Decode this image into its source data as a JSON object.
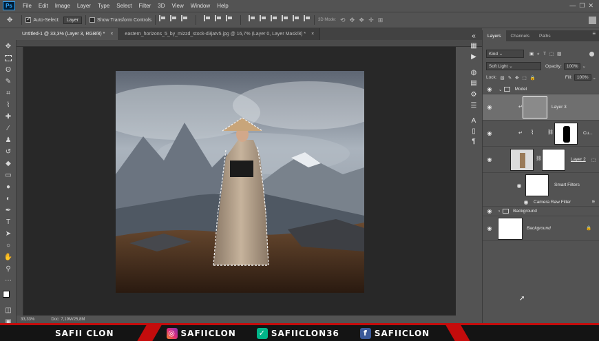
{
  "app": {
    "logo": "Ps"
  },
  "menu": [
    "File",
    "Edit",
    "Image",
    "Layer",
    "Type",
    "Select",
    "Filter",
    "3D",
    "View",
    "Window",
    "Help"
  ],
  "options_bar": {
    "auto_select_label": "Auto-Select:",
    "auto_select_value": "Layer",
    "transform_label": "Show Transform Controls",
    "mode_label": "3D Mode:"
  },
  "doc_tabs": [
    {
      "title": "Untitled-1 @ 33,3% (Layer 3, RGB/8) *",
      "close": "×"
    },
    {
      "title": "eastern_horizons_5_by_mizzd_stock-d3jatv5.jpg @ 16,7% (Layer 0, Layer Mask/8) *",
      "close": "×"
    }
  ],
  "status": {
    "zoom": "33,33%",
    "doc": "Doc: 7,19M/25,8M"
  },
  "panel": {
    "tabs": [
      "Layers",
      "Channels",
      "Paths"
    ],
    "kind": "Kind",
    "blend_mode": "Soft Light",
    "opacity_label": "Opacity:",
    "opacity_value": "100%",
    "lock_label": "Lock:",
    "fill_label": "Fill:",
    "fill_value": "100%",
    "layers": [
      {
        "name": "Model",
        "type": "group"
      },
      {
        "name": "Layer 3",
        "type": "layer"
      },
      {
        "name": "Cu...",
        "type": "adjustment"
      },
      {
        "name": "Layer 2",
        "type": "smart"
      },
      {
        "name": "Smart Filters",
        "type": "filters"
      },
      {
        "name": "Camera Raw Filter",
        "type": "filter"
      },
      {
        "name": "Background",
        "type": "group"
      },
      {
        "name": "Background",
        "type": "background"
      }
    ]
  },
  "banner": {
    "name": "SAFII CLON",
    "instagram": "SAFIICLON",
    "vine": "SAFIICLON36",
    "facebook": "SAFIICLON"
  },
  "colors": {
    "accent": "#31a8ff",
    "banner_red": "#c40c0c",
    "panel": "#535353",
    "canvas": "#282828"
  },
  "icons": [
    "move-icon",
    "marquee-icon",
    "lasso-icon",
    "quick-select-icon",
    "crop-icon",
    "eyedropper-icon",
    "healing-icon",
    "brush-icon",
    "stamp-icon",
    "history-brush-icon",
    "eraser-icon",
    "gradient-icon",
    "blur-icon",
    "dodge-icon",
    "pen-icon",
    "type-icon",
    "path-select-icon",
    "shape-icon",
    "hand-icon",
    "zoom-icon"
  ]
}
